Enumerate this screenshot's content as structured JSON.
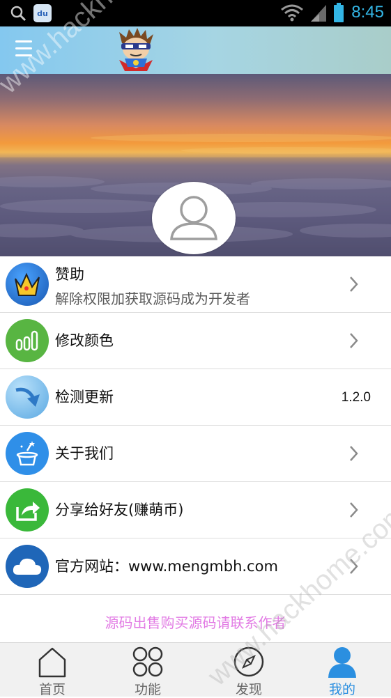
{
  "status_bar": {
    "time": "8:45",
    "baidu_badge": "du"
  },
  "header": {
    "menu_icon": "hamburger-icon",
    "mascot": "superhero-mascot-logo"
  },
  "banner": {
    "image": "sunset-above-clouds",
    "avatar_icon": "user-silhouette-icon"
  },
  "menu": [
    {
      "title": "赞助",
      "subtitle": "解除权限加获取源码成为开发者",
      "icon": "crown-icon",
      "icon_bg": "#1c6fbf",
      "trailing": "chevron"
    },
    {
      "title": "修改颜色",
      "icon": "bars-icon",
      "icon_bg": "#58b542",
      "trailing": "chevron"
    },
    {
      "title": "检测更新",
      "icon": "update-arrow-icon",
      "icon_bg": "#6fb7e8",
      "value": "1.2.0"
    },
    {
      "title": "关于我们",
      "icon": "magic-hat-icon",
      "icon_bg": "#2f8fe8",
      "trailing": "chevron"
    },
    {
      "title": "分享给好友(赚萌币)",
      "icon": "share-icon",
      "icon_bg": "#3ab83a",
      "trailing": "chevron"
    },
    {
      "title": "官方网站：www.mengmbh.com",
      "icon": "cloud-icon",
      "icon_bg": "#1f66b8",
      "trailing": "chevron"
    }
  ],
  "footer_note": "源码出售购买源码请联系作者",
  "bottom_nav": [
    {
      "label": "首页",
      "icon": "home-icon"
    },
    {
      "label": "功能",
      "icon": "grid-icon"
    },
    {
      "label": "发现",
      "icon": "compass-icon"
    },
    {
      "label": "我的",
      "icon": "person-icon",
      "active": true
    }
  ],
  "watermark": "www.hackhome.com",
  "colors": {
    "accent": "#2b8fe0",
    "status_text": "#33b5e5",
    "footer_text": "#e27be4"
  }
}
